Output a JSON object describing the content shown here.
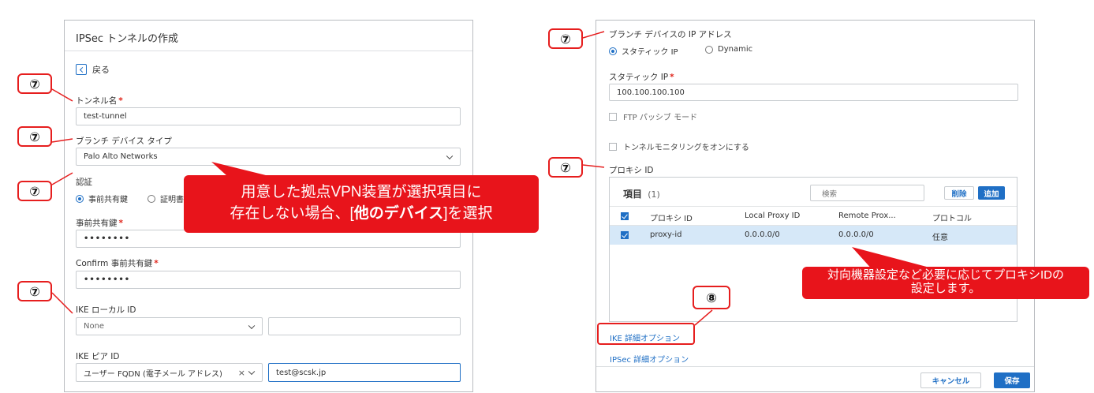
{
  "left_panel": {
    "title": "IPSec トンネルの作成",
    "back_label": "戻る",
    "tunnel_name_label": "トンネル名",
    "tunnel_name_value": "test-tunnel",
    "branch_type_label": "ブランチ デバイス タイプ",
    "branch_type_value": "Palo Alto Networks",
    "auth_label": "認証",
    "auth_option_psk": "事前共有鍵",
    "auth_option_cert": "証明書",
    "psk_label": "事前共有鍵",
    "psk_value": "••••••••",
    "confirm_psk_label": "Confirm 事前共有鍵",
    "confirm_psk_value": "••••••••",
    "ike_local_id_label": "IKE ローカル ID",
    "ike_local_id_select": "None",
    "ike_peer_id_label": "IKE ピア ID",
    "ike_peer_id_select": "ユーザー FQDN (電子メール アドレス)",
    "ike_peer_id_value": "test@scsk.jp",
    "required_mark": "*"
  },
  "right_panel": {
    "branch_ip_label": "ブランチ デバイスの IP アドレス",
    "ip_option_static": "スタティック IP",
    "ip_option_dynamic": "Dynamic",
    "static_ip_label": "スタティック IP",
    "static_ip_value": "100.100.100.100",
    "ftp_passive_label": "FTP パッシブ モード",
    "tunnel_monitor_label": "トンネルモニタリングをオンにする",
    "proxy_id_label": "プロキシ ID",
    "table_title": "項目",
    "table_count": "(1)",
    "search_placeholder": "検索",
    "delete_label": "削除",
    "add_label": "追加",
    "columns": [
      "プロキシ ID",
      "Local Proxy ID",
      "Remote Prox...",
      "プロトコル"
    ],
    "rows": [
      [
        "proxy-id",
        "0.0.0.0/0",
        "0.0.0.0/0",
        "任意"
      ]
    ],
    "ike_advanced_link": "IKE 詳細オプション",
    "ipsec_advanced_link": "IPSec 詳細オプション",
    "cancel_label": "キャンセル",
    "save_label": "保存",
    "required_mark": "*"
  },
  "annotations": {
    "marker_7": "⑦",
    "marker_8": "⑧",
    "callout_left_line1": "用意した拠点VPN装置が選択項目に",
    "callout_left_line2_prefix": "存在しない場合、[",
    "callout_left_line2_bold": "他のデバイス",
    "callout_left_line2_suffix": "]を選択",
    "callout_right_line1": "対向機器設定など必要に応じてプロキシIDの",
    "callout_right_line2": "設定します。",
    "color_callout": "#e8141b",
    "color_accent": "#1f6fc5"
  }
}
